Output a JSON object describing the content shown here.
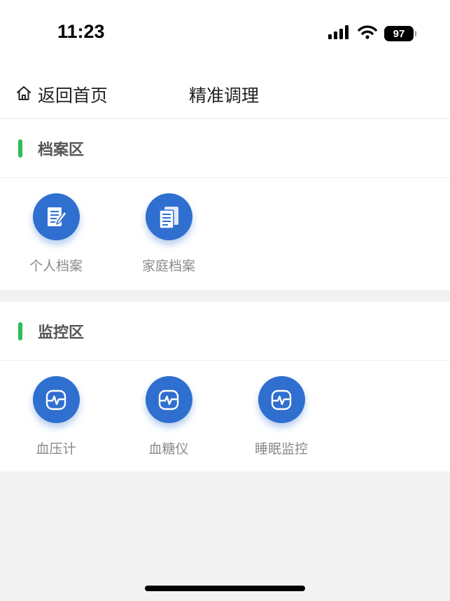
{
  "status_bar": {
    "time": "11:23",
    "battery": "97"
  },
  "nav": {
    "back_label": "返回首页",
    "title": "精准调理"
  },
  "sections": [
    {
      "title": "档案区",
      "items": [
        {
          "label": "个人档案",
          "icon": "document-edit-icon"
        },
        {
          "label": "家庭档案",
          "icon": "documents-icon"
        }
      ]
    },
    {
      "title": "监控区",
      "items": [
        {
          "label": "血压计",
          "icon": "heart-monitor-icon"
        },
        {
          "label": "血糖仪",
          "icon": "heart-monitor-icon"
        },
        {
          "label": "睡眠监控",
          "icon": "heart-monitor-icon"
        }
      ]
    }
  ],
  "colors": {
    "accent_bar": "#2ebd59",
    "icon_bg": "#2f6fcf"
  }
}
